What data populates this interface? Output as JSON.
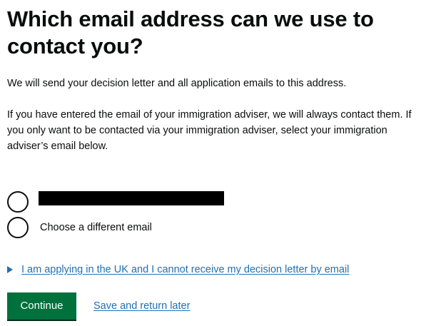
{
  "heading": "Which email address can we use to contact you?",
  "intro": {
    "paragraph_1": "We will send your decision letter and all application emails to this address.",
    "paragraph_2": "If you have entered the email of your immigration adviser, we will always contact them. If you only want to be contacted via your immigration adviser, select your immigration adviser’s email below."
  },
  "options": [
    {
      "label": "",
      "redacted": true,
      "selected": false
    },
    {
      "label": "Choose a different email",
      "redacted": false,
      "selected": false
    }
  ],
  "details": {
    "summary": "I am applying in the UK and I cannot receive my decision letter by email"
  },
  "actions": {
    "continue_label": "Continue",
    "save_label": "Save and return later"
  },
  "colors": {
    "text": "#0b0c0c",
    "link": "#1d70b8",
    "button": "#00703c",
    "redaction": "#000000"
  }
}
